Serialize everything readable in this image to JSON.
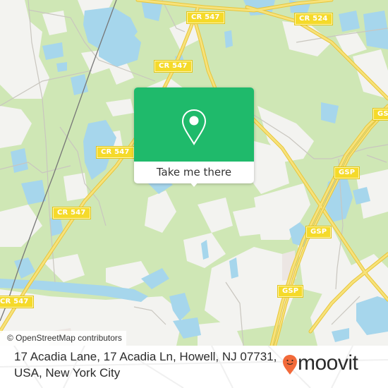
{
  "map": {
    "colors": {
      "background": "#f2f2ef",
      "forest": "#cfe7b5",
      "water": "#a6d6ec",
      "road_major": "#f3d54a",
      "road_minor": "#c9c6bf",
      "rail": "#777777",
      "popup_green": "#1fba6b"
    },
    "road_labels": [
      {
        "id": "cr547-top",
        "text": "CR 547"
      },
      {
        "id": "cr524",
        "text": "CR 524"
      },
      {
        "id": "cr547-upper",
        "text": "CR 547"
      },
      {
        "id": "cr547-mid-left",
        "text": "CR 547"
      },
      {
        "id": "cr547-mid",
        "text": "CR 547"
      },
      {
        "id": "cr547-bottom-left",
        "text": "CR 547"
      },
      {
        "id": "gsp-top-right",
        "text": "GSP"
      },
      {
        "id": "gsp-upper",
        "text": "GSP"
      },
      {
        "id": "gsp-middle",
        "text": "GSP"
      },
      {
        "id": "gsp-lower",
        "text": "GSP"
      }
    ],
    "attribution": "© OpenStreetMap contributors"
  },
  "popup": {
    "icon": "map-pin-icon",
    "button_label": "Take me there"
  },
  "footer": {
    "address": "17 Acadia Lane, 17 Acadia Ln, Howell, NJ 07731, USA, New York City",
    "brand": {
      "name": "moovit",
      "icon": "moovit-smiley-pin-icon",
      "pin_color": "#f26a3a"
    }
  }
}
